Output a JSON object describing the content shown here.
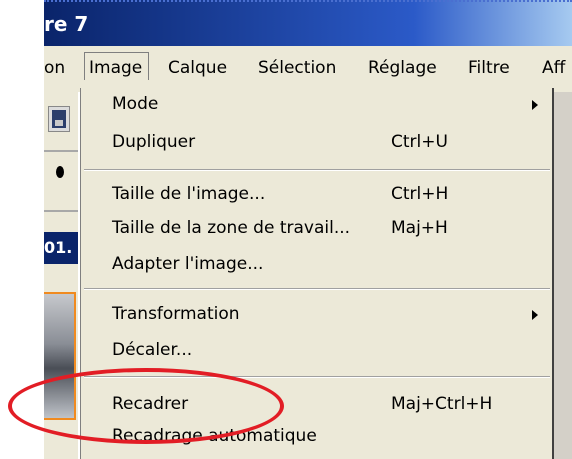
{
  "window": {
    "title": "re 7"
  },
  "menubar": {
    "items": [
      {
        "label": "on"
      },
      {
        "label": "Image"
      },
      {
        "label": "Calque"
      },
      {
        "label": "Sélection"
      },
      {
        "label": "Réglage"
      },
      {
        "label": "Filtre"
      },
      {
        "label": "Aff"
      }
    ]
  },
  "document_tab": {
    "label": "01."
  },
  "image_menu": {
    "items": [
      {
        "label": "Mode",
        "shortcut": "",
        "submenu": true
      },
      {
        "label": "Dupliquer",
        "shortcut": "Ctrl+U"
      },
      {
        "label": "Taille de l'image...",
        "shortcut": "Ctrl+H"
      },
      {
        "label": "Taille de la zone de travail...",
        "shortcut": "Maj+H"
      },
      {
        "label": "Adapter l'image...",
        "shortcut": ""
      },
      {
        "label": "Transformation",
        "shortcut": "",
        "submenu": true
      },
      {
        "label": "Décaler...",
        "shortcut": ""
      },
      {
        "label": "Recadrer",
        "shortcut": "Maj+Ctrl+H"
      },
      {
        "label": "Recadrage automatique",
        "shortcut": ""
      }
    ]
  },
  "colors": {
    "highlight_ellipse": "#e21d25",
    "menu_bg": "#ece9d8",
    "title_bg": "#0a246a"
  }
}
